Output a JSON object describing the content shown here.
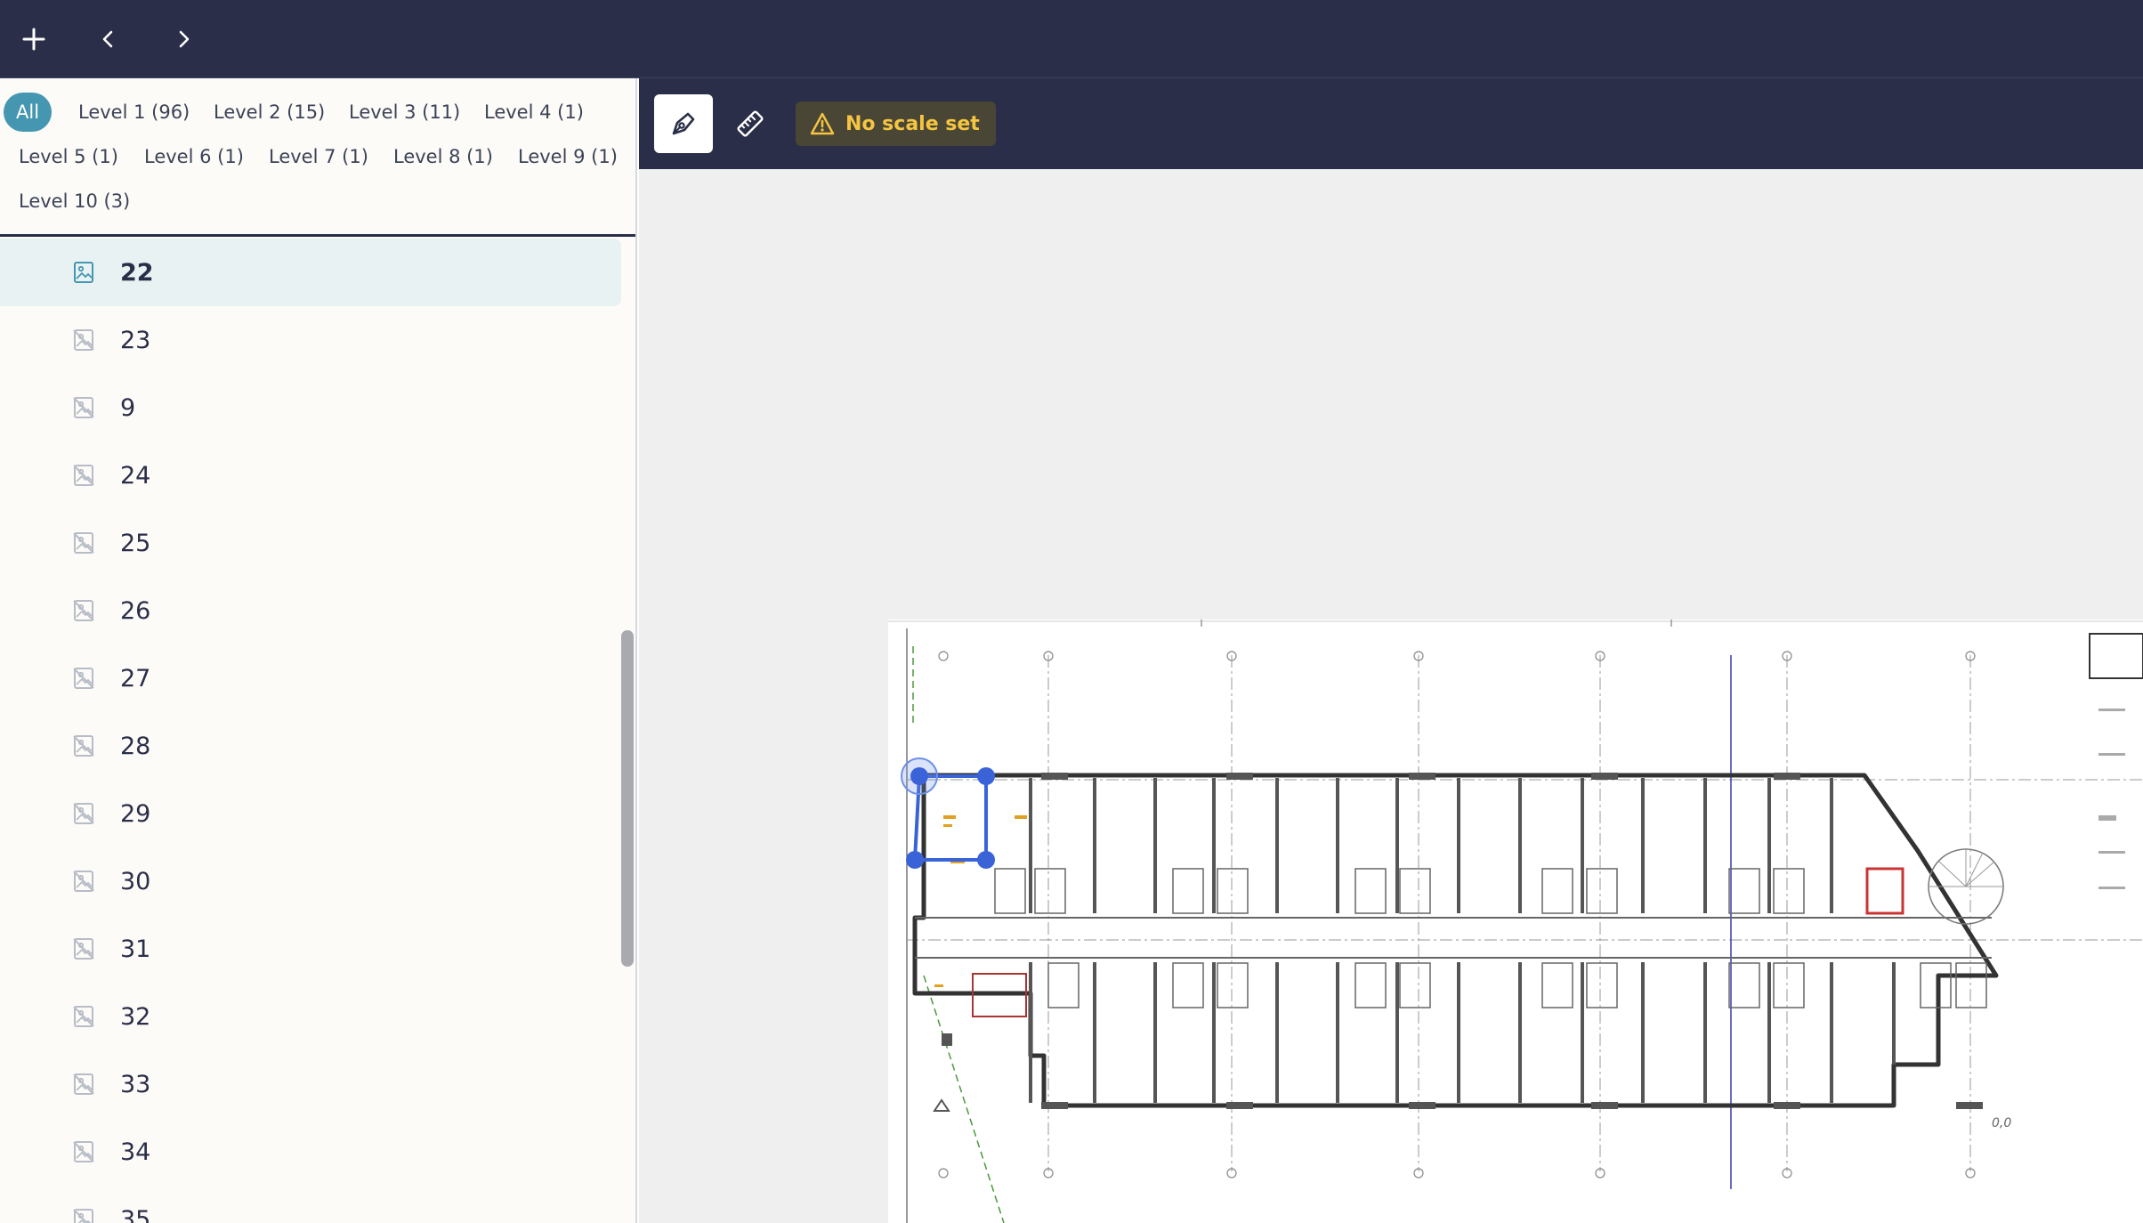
{
  "filters": [
    {
      "label": "All",
      "active": true
    },
    {
      "label": "Level 1 (96)"
    },
    {
      "label": "Level 2 (15)"
    },
    {
      "label": "Level 3 (11)"
    },
    {
      "label": "Level 4 (1)"
    },
    {
      "label": "Level 5 (1)"
    },
    {
      "label": "Level 6 (1)"
    },
    {
      "label": "Level 7 (1)"
    },
    {
      "label": "Level 8 (1)"
    },
    {
      "label": "Level 9 (1)"
    },
    {
      "label": "Level 10 (3)"
    }
  ],
  "sheets": [
    "22",
    "23",
    "9",
    "24",
    "25",
    "26",
    "27",
    "28",
    "29",
    "30",
    "31",
    "32",
    "33",
    "34",
    "35"
  ],
  "selected_sheet": "22",
  "toolbar": {
    "warning_label": "No scale set",
    "warning_color": "#f5c542"
  },
  "drawing": {
    "origin_label": "0,0"
  },
  "colors": {
    "nav": "#2a2e48",
    "accent": "#4596b0",
    "selection": "#3b63d8"
  }
}
